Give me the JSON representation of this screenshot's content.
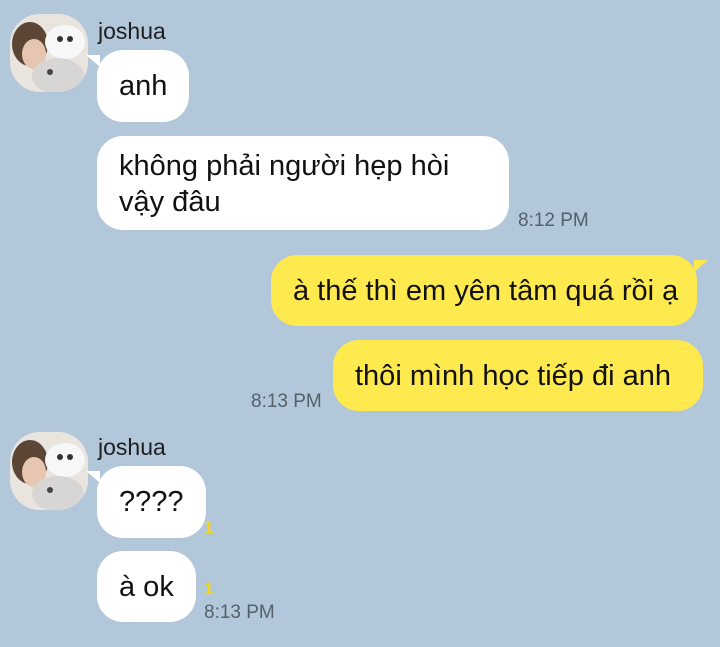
{
  "messages": {
    "group1": {
      "sender": "joshua",
      "bubble1": "anh",
      "bubble2": "không phải người hẹp hòi vậy đâu",
      "time": "8:12 PM"
    },
    "group2": {
      "bubble1": "à thế thì em yên tâm quá rồi ạ",
      "bubble2": "thôi mình học tiếp đi anh",
      "time": "8:13 PM"
    },
    "group3": {
      "sender": "joshua",
      "bubble1": "????",
      "bubble1_unread": "1",
      "bubble2": "à ok",
      "bubble2_unread": "1",
      "time": "8:13 PM"
    }
  }
}
